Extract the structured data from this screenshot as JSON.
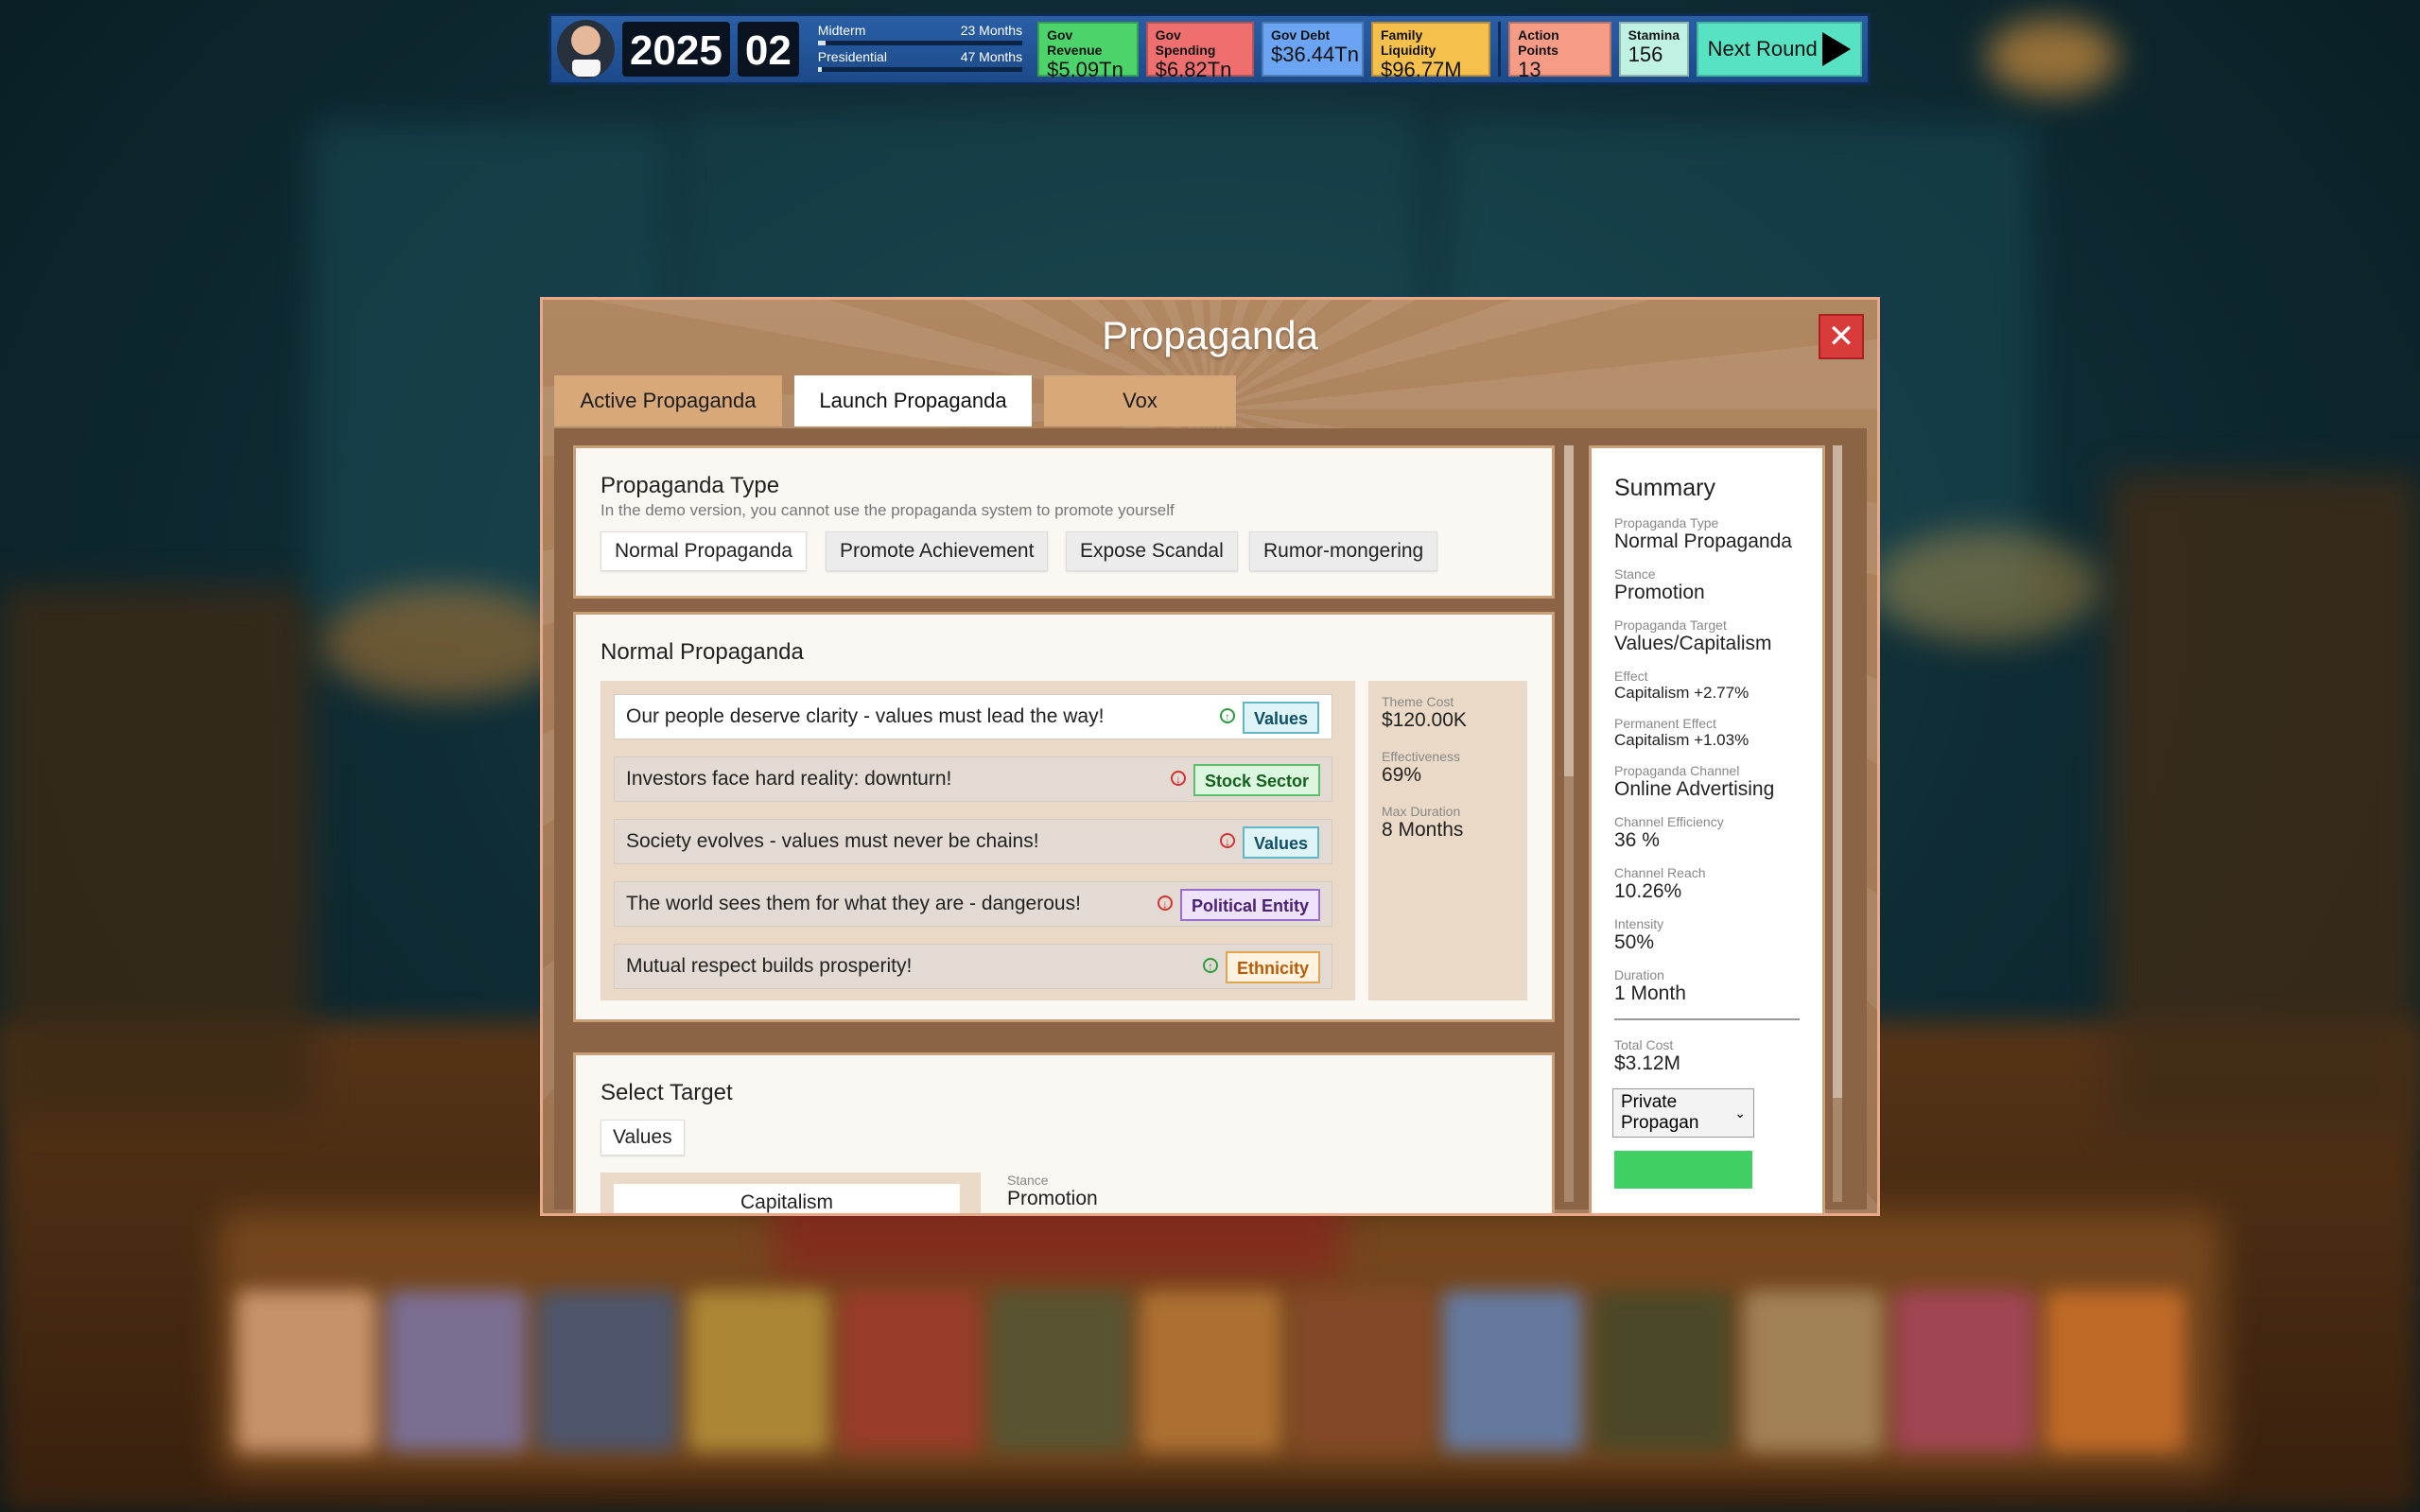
{
  "hud": {
    "year": "2025",
    "month": "02",
    "midterm_label": "Midterm",
    "midterm_value": "23 Months",
    "midterm_progress": 0.04,
    "presidential_label": "Presidential",
    "presidential_value": "47 Months",
    "presidential_progress": 0.02,
    "gov_revenue_label": "Gov Revenue",
    "gov_revenue_value": "$5.09Tn",
    "gov_spending_label": "Gov Spending",
    "gov_spending_value": "$6.82Tn",
    "gov_debt_label": "Gov Debt",
    "gov_debt_value": "$36.44Tn",
    "family_liquidity_label": "Family Liquidity",
    "family_liquidity_value": "$96.77M",
    "action_points_label": "Action Points",
    "action_points_value": "13",
    "stamina_label": "Stamina",
    "stamina_value": "156",
    "next_round_label": "Next Round"
  },
  "modal": {
    "title": "Propaganda",
    "close_icon": "close-icon",
    "tabs": [
      {
        "label": "Active Propaganda"
      },
      {
        "label": "Launch Propaganda",
        "selected": true
      },
      {
        "label": "Vox"
      }
    ]
  },
  "propaganda_type": {
    "heading": "Propaganda Type",
    "note": "In the demo version, you cannot use the propaganda system to promote yourself",
    "options": [
      {
        "label": "Normal Propaganda",
        "selected": true
      },
      {
        "label": "Promote Achievement"
      },
      {
        "label": "Expose Scandal"
      },
      {
        "label": "Rumor-mongering"
      }
    ]
  },
  "normal_propaganda": {
    "heading": "Normal Propaganda",
    "themes": [
      {
        "text": "Our people deserve clarity - values must lead the way!",
        "direction": "up",
        "tag": "Values",
        "selected": true
      },
      {
        "text": "Investors face hard reality: downturn!",
        "direction": "down",
        "tag": "Stock Sector"
      },
      {
        "text": "Society evolves - values must never be chains!",
        "direction": "down",
        "tag": "Values"
      },
      {
        "text": "The world sees them for what they are - dangerous!",
        "direction": "down",
        "tag": "Political Entity"
      },
      {
        "text": "Mutual respect builds prosperity!",
        "direction": "up",
        "tag": "Ethnicity"
      }
    ],
    "stats": {
      "theme_cost_label": "Theme Cost",
      "theme_cost_value": "$120.00K",
      "effectiveness_label": "Effectiveness",
      "effectiveness_value": "69%",
      "max_duration_label": "Max Duration",
      "max_duration_value": "8 Months"
    }
  },
  "select_target": {
    "heading": "Select Target",
    "category": "Values",
    "list_item": "Capitalism",
    "stance_label": "Stance",
    "stance_value": "Promotion"
  },
  "summary": {
    "heading": "Summary",
    "type_label": "Propaganda Type",
    "type_value": "Normal Propaganda",
    "stance_label": "Stance",
    "stance_value": "Promotion",
    "target_label": "Propaganda Target",
    "target_value": "Values/Capitalism",
    "effect_label": "Effect",
    "effect_value": "Capitalism +2.77%",
    "perm_effect_label": "Permanent Effect",
    "perm_effect_value": "Capitalism +1.03%",
    "channel_label": "Propaganda Channel",
    "channel_value": "Online Advertising",
    "channel_eff_label": "Channel Efficiency",
    "channel_eff_value": "36 %",
    "channel_reach_label": "Channel Reach",
    "channel_reach_value": "10.26%",
    "intensity_label": "Intensity",
    "intensity_value": "50%",
    "duration_label": "Duration",
    "duration_value": "1 Month",
    "total_cost_label": "Total Cost",
    "total_cost_value": "$3.12M",
    "channel_select_value": "Private Propagan"
  },
  "colors": {
    "up_icon": "#2e9a3e",
    "down_icon": "#d63131",
    "launch_button": "#3fcf63",
    "close_button": "#d93b3b"
  }
}
